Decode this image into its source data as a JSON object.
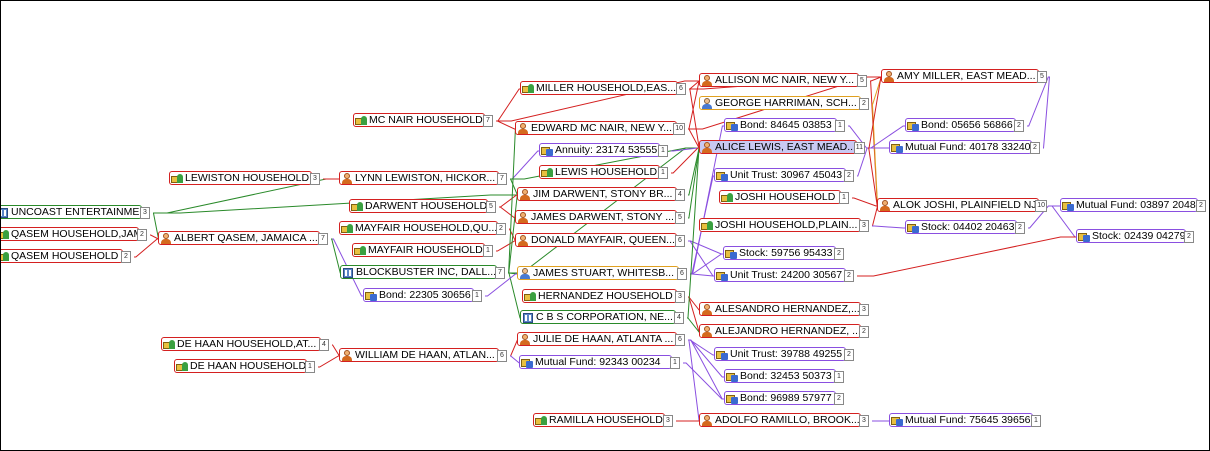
{
  "diagram": {
    "nodes": [
      {
        "id": "n_suncoast",
        "label": "UNCOAST ENTERTAINME...",
        "kind": "org",
        "count": "3"
      },
      {
        "id": "n_qasem_hh_jam",
        "label": "QASEM HOUSEHOLD,JAM...",
        "kind": "house",
        "count": "2"
      },
      {
        "id": "n_qasem_hh",
        "label": "QASEM HOUSEHOLD",
        "kind": "house",
        "count": "2"
      },
      {
        "id": "n_lewiston_hh",
        "label": "LEWISTON HOUSEHOLD",
        "kind": "house",
        "count": "3"
      },
      {
        "id": "n_albert",
        "label": "ALBERT QASEM, JAMAICA ...",
        "kind": "person",
        "count": "7"
      },
      {
        "id": "n_mcnair_hh",
        "label": "MC NAIR HOUSEHOLD",
        "kind": "house",
        "count": "7"
      },
      {
        "id": "n_lynn",
        "label": "LYNN LEWISTON, HICKOR...",
        "kind": "person",
        "count": "7"
      },
      {
        "id": "n_darwent_hh",
        "label": "DARWENT HOUSEHOLD",
        "kind": "house",
        "count": "5"
      },
      {
        "id": "n_mayfair_hh_qu",
        "label": "MAYFAIR HOUSEHOLD,QU...",
        "kind": "house",
        "count": "2"
      },
      {
        "id": "n_mayfair_hh",
        "label": "MAYFAIR HOUSEHOLD",
        "kind": "house",
        "count": "1"
      },
      {
        "id": "n_blockbuster",
        "label": "BLOCKBUSTER INC, DALL...",
        "kind": "org",
        "count": "7"
      },
      {
        "id": "n_bond_22305",
        "label": "Bond: 22305 30656",
        "kind": "acct",
        "count": "1"
      },
      {
        "id": "n_dehaan_hh_at",
        "label": "DE HAAN HOUSEHOLD,AT...",
        "kind": "house",
        "count": "4"
      },
      {
        "id": "n_dehaan_hh",
        "label": "DE HAAN HOUSEHOLD",
        "kind": "house",
        "count": "1"
      },
      {
        "id": "n_william",
        "label": "WILLIAM DE HAAN, ATLAN...",
        "kind": "person",
        "count": "6"
      },
      {
        "id": "n_miller_hh",
        "label": "MILLER HOUSEHOLD,EAS...",
        "kind": "house",
        "count": "6"
      },
      {
        "id": "n_edward",
        "label": "EDWARD MC NAIR, NEW Y...",
        "kind": "person",
        "count": "10"
      },
      {
        "id": "n_annuity",
        "label": "Annuity: 23174 53555",
        "kind": "acct",
        "count": "1"
      },
      {
        "id": "n_lewis_hh",
        "label": "LEWIS HOUSEHOLD",
        "kind": "house",
        "count": "1"
      },
      {
        "id": "n_jim",
        "label": "JIM DARWENT, STONY BR...",
        "kind": "person",
        "count": "4"
      },
      {
        "id": "n_james_d",
        "label": "JAMES DARWENT, STONY ...",
        "kind": "person",
        "count": "5"
      },
      {
        "id": "n_donald",
        "label": "DONALD MAYFAIR, QUEEN...",
        "kind": "person",
        "count": "6"
      },
      {
        "id": "n_james_s",
        "label": "JAMES STUART, WHITESB...",
        "kind": "contact",
        "count": "6"
      },
      {
        "id": "n_hernandez_hh",
        "label": "HERNANDEZ HOUSEHOLD",
        "kind": "house",
        "count": "3"
      },
      {
        "id": "n_cbs",
        "label": "C B S CORPORATION, NE...",
        "kind": "org",
        "count": "4"
      },
      {
        "id": "n_julie",
        "label": "JULIE DE HAAN, ATLANTA ...",
        "kind": "person",
        "count": "6"
      },
      {
        "id": "n_mf_92343",
        "label": "Mutual Fund: 92343 00234",
        "kind": "acct",
        "count": "1"
      },
      {
        "id": "n_ramilla_hh",
        "label": "RAMILLA HOUSEHOLD",
        "kind": "house",
        "count": "3"
      },
      {
        "id": "n_allison",
        "label": "ALLISON MC NAIR, NEW Y...",
        "kind": "person",
        "count": "5"
      },
      {
        "id": "n_george",
        "label": "GEORGE HARRIMAN, SCH...",
        "kind": "contact",
        "count": "2"
      },
      {
        "id": "n_bond_84645",
        "label": "Bond: 84645 03853",
        "kind": "acct",
        "count": "1"
      },
      {
        "id": "n_alice",
        "label": "ALICE LEWIS, EAST MEAD...",
        "kind": "person",
        "count": "11",
        "selected": true
      },
      {
        "id": "n_ut_30967",
        "label": "Unit Trust: 30967 45043",
        "kind": "acct",
        "count": "2"
      },
      {
        "id": "n_joshi_hh",
        "label": "JOSHI HOUSEHOLD",
        "kind": "house",
        "count": "1"
      },
      {
        "id": "n_joshi_hh_plain",
        "label": "JOSHI HOUSEHOLD,PLAIN...",
        "kind": "house",
        "count": "3"
      },
      {
        "id": "n_stock_59756",
        "label": "Stock: 59756 95433",
        "kind": "acct",
        "count": "2"
      },
      {
        "id": "n_ut_24200",
        "label": "Unit Trust: 24200 30567",
        "kind": "acct",
        "count": "2"
      },
      {
        "id": "n_alesandro",
        "label": "ALESANDRO HERNANDEZ,...",
        "kind": "person",
        "count": "3"
      },
      {
        "id": "n_alejandro",
        "label": "ALEJANDRO HERNANDEZ, ...",
        "kind": "person",
        "count": "2"
      },
      {
        "id": "n_ut_39788",
        "label": "Unit Trust: 39788 49255",
        "kind": "acct",
        "count": "2"
      },
      {
        "id": "n_bond_32453",
        "label": "Bond: 32453 50373",
        "kind": "acct",
        "count": "1"
      },
      {
        "id": "n_bond_96989",
        "label": "Bond: 96989 57977",
        "kind": "acct",
        "count": "2"
      },
      {
        "id": "n_adolfo",
        "label": "ADOLFO RAMILLO, BROOK...",
        "kind": "person",
        "count": "3"
      },
      {
        "id": "n_mf_75645",
        "label": "Mutual Fund: 75645 39656",
        "kind": "acct",
        "count": "1"
      },
      {
        "id": "n_amy",
        "label": "AMY MILLER, EAST MEAD...",
        "kind": "person",
        "count": "5"
      },
      {
        "id": "n_bond_05656",
        "label": "Bond: 05656 56866",
        "kind": "acct",
        "count": "2"
      },
      {
        "id": "n_mf_40178",
        "label": "Mutual Fund: 40178 33240",
        "kind": "acct",
        "count": "2"
      },
      {
        "id": "n_alok",
        "label": "ALOK JOSHI, PLAINFIELD NJ",
        "kind": "person",
        "count": "10"
      },
      {
        "id": "n_stock_04402",
        "label": "Stock: 04402 20463",
        "kind": "acct",
        "count": "2"
      },
      {
        "id": "n_mf_03897",
        "label": "Mutual Fund: 03897 20486",
        "kind": "acct",
        "count": "2"
      },
      {
        "id": "n_stock_02439",
        "label": "Stock: 02439 04279",
        "kind": "acct",
        "count": "2"
      }
    ],
    "edges": [
      [
        "n_suncoast",
        "n_albert",
        "green"
      ],
      [
        "n_suncoast",
        "n_jim",
        "green"
      ],
      [
        "n_suncoast",
        "n_lynn",
        "green"
      ],
      [
        "n_qasem_hh_jam",
        "n_albert",
        "red"
      ],
      [
        "n_qasem_hh",
        "n_albert",
        "red"
      ],
      [
        "n_lewiston_hh",
        "n_lynn",
        "red"
      ],
      [
        "n_albert",
        "n_bond_22305",
        "purple"
      ],
      [
        "n_albert",
        "n_blockbuster",
        "green"
      ],
      [
        "n_mcnair_hh",
        "n_edward",
        "red"
      ],
      [
        "n_mcnair_hh",
        "n_allison",
        "red"
      ],
      [
        "n_mcnair_hh",
        "n_miller_hh",
        "red"
      ],
      [
        "n_lynn",
        "n_annuity",
        "purple"
      ],
      [
        "n_lynn",
        "n_alice",
        "green"
      ],
      [
        "n_lynn",
        "n_jim",
        "green"
      ],
      [
        "n_darwent_hh",
        "n_jim",
        "red"
      ],
      [
        "n_darwent_hh",
        "n_james_d",
        "red"
      ],
      [
        "n_mayfair_hh_qu",
        "n_donald",
        "red"
      ],
      [
        "n_mayfair_hh",
        "n_donald",
        "red"
      ],
      [
        "n_blockbuster",
        "n_james_s",
        "green"
      ],
      [
        "n_blockbuster",
        "n_alice",
        "green"
      ],
      [
        "n_blockbuster",
        "n_jim",
        "green"
      ],
      [
        "n_blockbuster",
        "n_cbs",
        "green"
      ],
      [
        "n_blockbuster",
        "n_edward",
        "green"
      ],
      [
        "n_bond_22305",
        "n_james_s",
        "purple"
      ],
      [
        "n_dehaan_hh_at",
        "n_william",
        "red"
      ],
      [
        "n_dehaan_hh",
        "n_william",
        "red"
      ],
      [
        "n_william",
        "n_julie",
        "red"
      ],
      [
        "n_william",
        "n_mf_92343",
        "purple"
      ],
      [
        "n_miller_hh",
        "n_amy",
        "red"
      ],
      [
        "n_miller_hh",
        "n_allison",
        "red"
      ],
      [
        "n_miller_hh",
        "n_alice",
        "red"
      ],
      [
        "n_edward",
        "n_allison",
        "red"
      ],
      [
        "n_edward",
        "n_alice",
        "red"
      ],
      [
        "n_edward",
        "n_amy",
        "red"
      ],
      [
        "n_annuity",
        "n_alice",
        "purple"
      ],
      [
        "n_lewis_hh",
        "n_alice",
        "red"
      ],
      [
        "n_jim",
        "n_alice",
        "green"
      ],
      [
        "n_james_d",
        "n_alice",
        "green"
      ],
      [
        "n_donald",
        "n_stock_59756",
        "purple"
      ],
      [
        "n_donald",
        "n_ut_24200",
        "purple"
      ],
      [
        "n_james_s",
        "n_stock_59756",
        "purple"
      ],
      [
        "n_james_s",
        "n_ut_24200",
        "purple"
      ],
      [
        "n_james_s",
        "n_bond_84645",
        "purple"
      ],
      [
        "n_james_s",
        "n_ut_30967",
        "purple"
      ],
      [
        "n_hernandez_hh",
        "n_alesandro",
        "red"
      ],
      [
        "n_hernandez_hh",
        "n_alejandro",
        "red"
      ],
      [
        "n_cbs",
        "n_alejandro",
        "green"
      ],
      [
        "n_cbs",
        "n_alice",
        "green"
      ],
      [
        "n_julie",
        "n_ut_39788",
        "purple"
      ],
      [
        "n_julie",
        "n_bond_32453",
        "purple"
      ],
      [
        "n_julie",
        "n_bond_96989",
        "purple"
      ],
      [
        "n_julie",
        "n_adolfo",
        "purple"
      ],
      [
        "n_mf_92343",
        "n_bond_96989",
        "purple"
      ],
      [
        "n_ramilla_hh",
        "n_adolfo",
        "red"
      ],
      [
        "n_allison",
        "n_amy",
        "red"
      ],
      [
        "n_allison",
        "n_alok",
        "red"
      ],
      [
        "n_george",
        "n_amy",
        "orange"
      ],
      [
        "n_george",
        "n_alok",
        "orange"
      ],
      [
        "n_bond_84645",
        "n_alice",
        "purple"
      ],
      [
        "n_alice",
        "n_bond_05656",
        "purple"
      ],
      [
        "n_alice",
        "n_mf_40178",
        "purple"
      ],
      [
        "n_alice",
        "n_amy",
        "red"
      ],
      [
        "n_alice",
        "n_alok",
        "red"
      ],
      [
        "n_alice",
        "n_ut_30967",
        "purple"
      ],
      [
        "n_joshi_hh",
        "n_alok",
        "red"
      ],
      [
        "n_joshi_hh_plain",
        "n_alok",
        "red"
      ],
      [
        "n_joshi_hh_plain",
        "n_stock_04402",
        "purple"
      ],
      [
        "n_adolfo",
        "n_mf_75645",
        "purple"
      ],
      [
        "n_amy",
        "n_bond_05656",
        "purple"
      ],
      [
        "n_amy",
        "n_mf_40178",
        "purple"
      ],
      [
        "n_alok",
        "n_mf_03897",
        "purple"
      ],
      [
        "n_alok",
        "n_stock_02439",
        "purple"
      ],
      [
        "n_alok",
        "n_stock_04402",
        "purple"
      ],
      [
        "n_ut_24200",
        "n_stock_02439",
        "red"
      ]
    ],
    "colors": {
      "red": "#d42020",
      "green": "#2a8a2a",
      "purple": "#8a4fe0",
      "orange": "#e0a020"
    }
  }
}
